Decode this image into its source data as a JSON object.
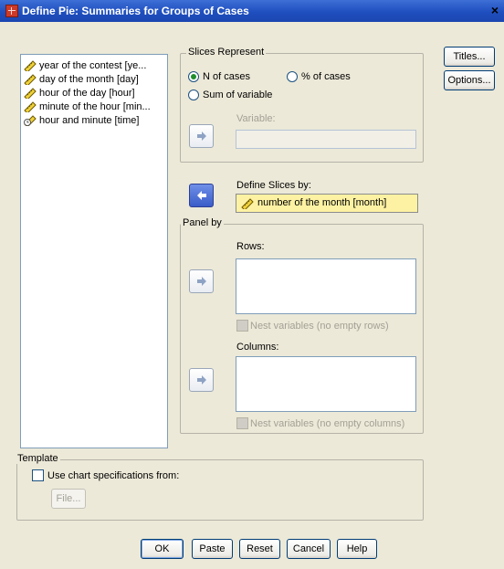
{
  "window": {
    "title": "Define Pie: Summaries for Groups of Cases",
    "close_glyph": "×"
  },
  "variables": [
    {
      "label": "year of the contest [ye...",
      "icon": "scale-ruler-icon"
    },
    {
      "label": "day of the month [day]",
      "icon": "scale-ruler-icon"
    },
    {
      "label": "hour of the day [hour]",
      "icon": "scale-ruler-icon"
    },
    {
      "label": "minute of the hour [min...",
      "icon": "scale-ruler-icon"
    },
    {
      "label": "hour and minute [time]",
      "icon": "date-time-ruler-icon"
    }
  ],
  "slices": {
    "legend": "Slices Represent",
    "n_cases": "N of cases",
    "pct_cases": "% of cases",
    "sum_var": "Sum of variable",
    "selected": "N of cases",
    "variable_label": "Variable:",
    "variable_value": ""
  },
  "define_slices": {
    "label": "Define Slices by:",
    "value": "number of the month [month]"
  },
  "panel": {
    "legend": "Panel by",
    "rows_label": "Rows:",
    "nest_rows": "Nest variables (no empty rows)",
    "cols_label": "Columns:",
    "nest_cols": "Nest variables (no empty columns)"
  },
  "template": {
    "legend": "Template",
    "use_chart": "Use chart specifications from:",
    "file_btn": "File..."
  },
  "side_buttons": {
    "titles": "Titles...",
    "options": "Options..."
  },
  "bottom_buttons": {
    "ok": "OK",
    "paste": "Paste",
    "reset": "Reset",
    "cancel": "Cancel",
    "help": "Help"
  }
}
